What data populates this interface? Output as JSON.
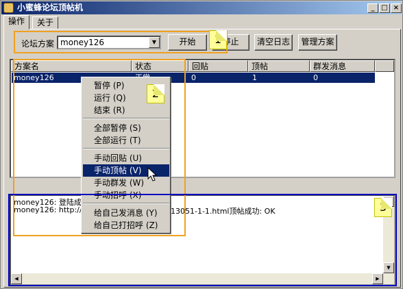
{
  "window": {
    "title": "小蜜蜂论坛顶帖机",
    "buttons": {
      "minimize": "_",
      "maximize": "□",
      "close": "×"
    }
  },
  "tabs": [
    {
      "label": "操作"
    },
    {
      "label": "关于"
    }
  ],
  "toolbar": {
    "scheme_label": "论坛方案",
    "scheme_value": "money126",
    "start_label": "开始",
    "stop_label": "停止",
    "clear_log_label": "清空日志",
    "manage_label": "管理方案"
  },
  "listview": {
    "columns": [
      "方案名",
      "状态",
      "回贴",
      "顶帖",
      "群发消息"
    ],
    "rows": [
      {
        "name": "money126",
        "status": "正常",
        "reply": "0",
        "bump": "1",
        "mass": "0"
      }
    ]
  },
  "context_menu": {
    "items": [
      {
        "label": "暂停 (P)"
      },
      {
        "label": "运行 (Q)"
      },
      {
        "label": "结束 (R)"
      },
      {
        "label": "全部暂停 (S)"
      },
      {
        "label": "全部运行 (T)"
      },
      {
        "label": "手动回贴 (U)"
      },
      {
        "label": "手动顶帖 (V)"
      },
      {
        "label": "手动群发 (W)"
      },
      {
        "label": "手动招呼 (X)"
      },
      {
        "label": "给自己发消息 (Y)"
      },
      {
        "label": "给自己打招呼 (Z)"
      }
    ],
    "highlighted_index": 6
  },
  "log": {
    "lines": [
      "money126: 登陆成功",
      "money126: http://w",
      "13051-1-1.html顶帖成功: OK"
    ]
  },
  "annotations": [
    {
      "label": "1"
    },
    {
      "label": "2"
    },
    {
      "label": "3"
    }
  ],
  "colors": {
    "title_bar": "#0a246a",
    "selection": "#0a246a",
    "annotation_orange": "#f0a020",
    "annotation_blue": "#0000c0",
    "callout_yellow": "#ffff99"
  }
}
